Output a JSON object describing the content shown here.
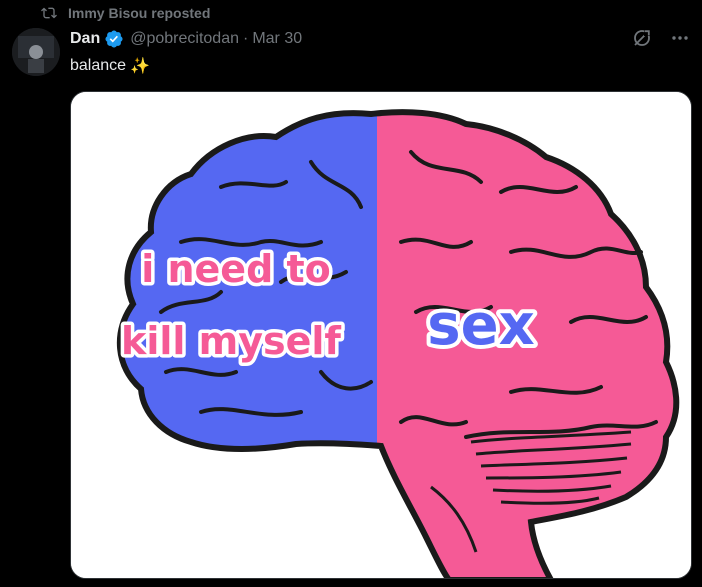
{
  "repost": {
    "label": "Immy Bisou reposted",
    "icon": "repost-icon"
  },
  "tweet": {
    "author_name": "Dan",
    "verified": true,
    "handle": "@pobrecitodan",
    "separator": "·",
    "date": "Mar 30",
    "text": "balance",
    "emoji": "✨",
    "media": {
      "left_caption_line1": "i need to",
      "left_caption_line2": "kill myself",
      "right_caption": "sex"
    }
  },
  "colors": {
    "background": "#000000",
    "text": "#e7e9ea",
    "muted": "#71767b",
    "verified": "#1d9bf0",
    "brain_left": "#5568f2",
    "brain_right": "#f55a96",
    "outline": "#1a1a1a"
  },
  "icons": {
    "verified": "verified-badge-icon",
    "grok": "grok-icon",
    "more": "more-icon"
  }
}
